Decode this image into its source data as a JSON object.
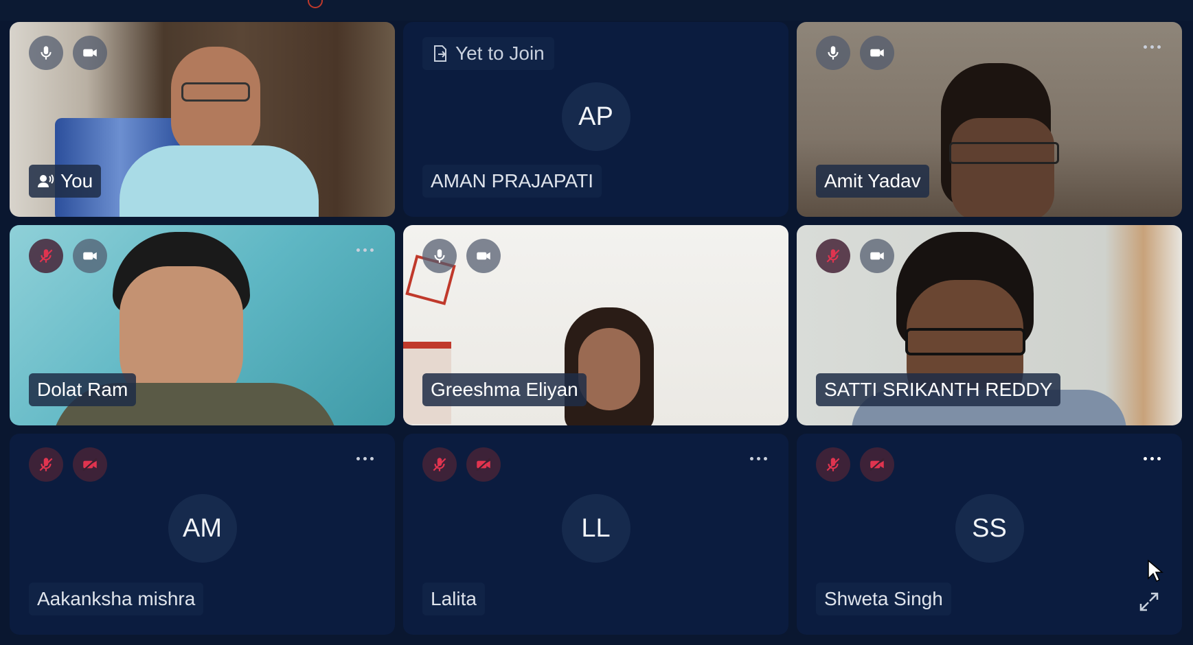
{
  "participants": [
    {
      "name": "You",
      "initials": "",
      "status": "",
      "mic": "on",
      "cam": "on",
      "video": true
    },
    {
      "name": "AMAN PRAJAPATI",
      "initials": "AP",
      "status": "Yet to Join",
      "video": false
    },
    {
      "name": "Amit Yadav",
      "initials": "",
      "status": "",
      "mic": "on",
      "cam": "on",
      "video": true
    },
    {
      "name": "Dolat Ram",
      "initials": "",
      "status": "",
      "mic": "off",
      "cam": "on",
      "video": true
    },
    {
      "name": "Greeshma Eliyan",
      "initials": "",
      "status": "",
      "mic": "on",
      "cam": "on",
      "video": true
    },
    {
      "name": "SATTI SRIKANTH REDDY",
      "initials": "",
      "status": "",
      "mic": "off",
      "cam": "on",
      "video": true
    },
    {
      "name": "Aakanksha mishra",
      "initials": "AM",
      "status": "",
      "mic": "off",
      "cam": "off",
      "video": false
    },
    {
      "name": "Lalita",
      "initials": "LL",
      "status": "",
      "mic": "off",
      "cam": "off",
      "video": false
    },
    {
      "name": "Shweta Singh",
      "initials": "SS",
      "status": "",
      "mic": "off",
      "cam": "off",
      "video": false
    }
  ],
  "colors": {
    "background": "#0a1730",
    "tile": "#0b1c3f",
    "muted_icon": "#e0344f",
    "icon": "#ffffff"
  },
  "icons": [
    "mic-icon",
    "camera-icon",
    "mic-off-icon",
    "camera-off-icon",
    "more-options-icon",
    "speaker-icon",
    "yet-to-join-icon",
    "expand-icon"
  ]
}
